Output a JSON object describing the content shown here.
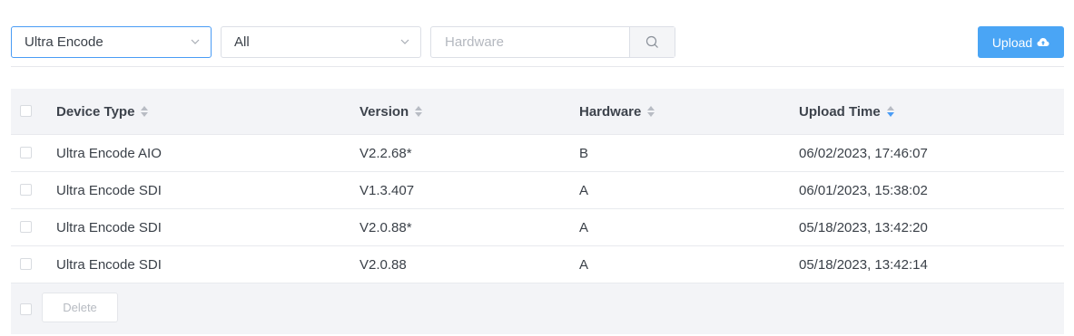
{
  "filters": {
    "device_select": {
      "value": "Ultra Encode"
    },
    "type_select": {
      "value": "All"
    },
    "search": {
      "placeholder": "Hardware",
      "value": ""
    }
  },
  "upload_button": {
    "label": "Upload",
    "icon": "cloud-upload-icon"
  },
  "table": {
    "columns": [
      {
        "label": "Device Type",
        "sort": "none"
      },
      {
        "label": "Version",
        "sort": "none"
      },
      {
        "label": "Hardware",
        "sort": "none"
      },
      {
        "label": "Upload Time",
        "sort": "descending"
      }
    ],
    "rows": [
      {
        "device_type": "Ultra Encode AIO",
        "version": "V2.2.68*",
        "hardware": "B",
        "upload_time": "06/02/2023, 17:46:07"
      },
      {
        "device_type": "Ultra Encode SDI",
        "version": "V1.3.407",
        "hardware": "A",
        "upload_time": "06/01/2023, 15:38:02"
      },
      {
        "device_type": "Ultra Encode SDI",
        "version": "V2.0.88*",
        "hardware": "A",
        "upload_time": "05/18/2023, 13:42:20"
      },
      {
        "device_type": "Ultra Encode SDI",
        "version": "V2.0.88",
        "hardware": "A",
        "upload_time": "05/18/2023, 13:42:14"
      }
    ]
  },
  "footer": {
    "delete_label": "Delete"
  },
  "colors": {
    "accent": "#4aa5f5",
    "header_bg": "#f3f4f7",
    "sort_active": "#4a9cf5",
    "sort_inactive": "#b8bcc4"
  }
}
